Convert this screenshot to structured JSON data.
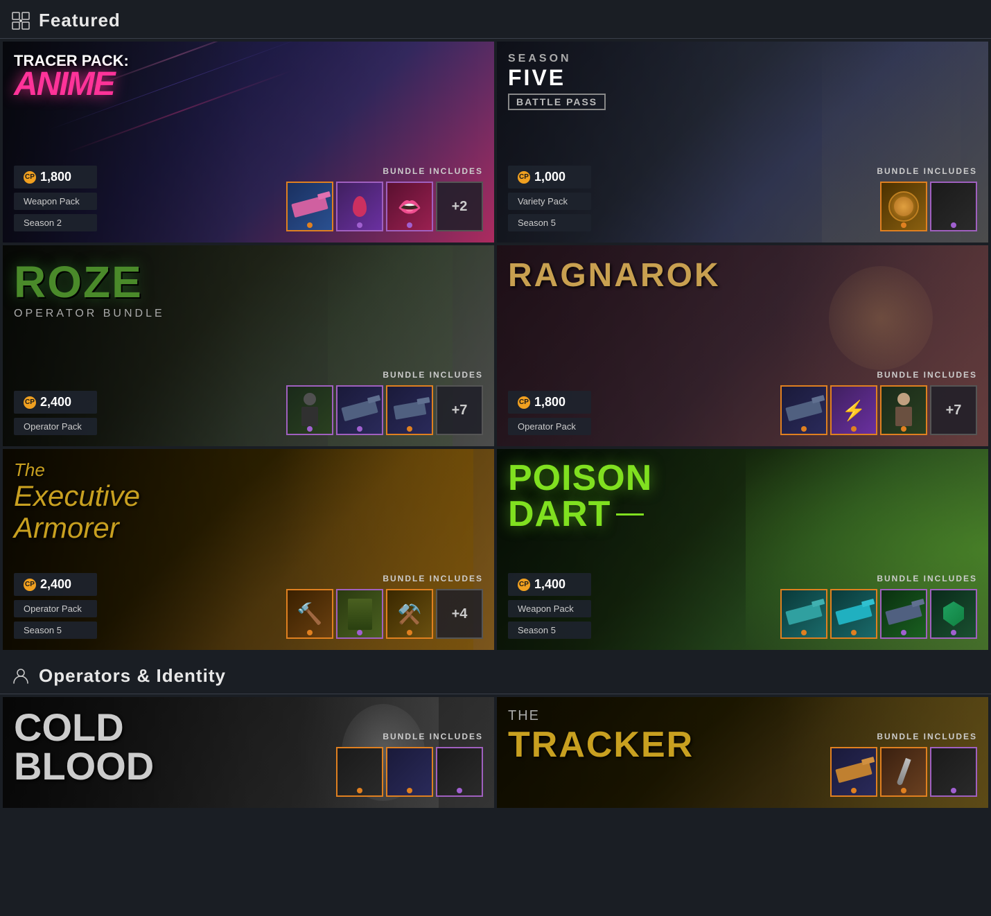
{
  "sections": {
    "featured": {
      "label": "Featured",
      "icon": "sparkle-icon"
    },
    "operators": {
      "label": "Operators & Identity",
      "icon": "person-icon"
    }
  },
  "featured_cards": [
    {
      "id": "tracer-anime",
      "title_line1": "TRACER PACK:",
      "title_line2": "ANIME",
      "price": "1,800",
      "tag1": "Weapon Pack",
      "tag2": "Season 2",
      "includes_label": "BUNDLE INCLUDES",
      "extra_count": "+2",
      "bg_class": "bg-tracer-anime"
    },
    {
      "id": "season5-bp",
      "title_line1": "SEASON FIVE",
      "title_line2": "BATTLE PASS",
      "price": "1,000",
      "tag1": "Variety Pack",
      "tag2": "Season 5",
      "includes_label": "BUNDLE INCLUDES",
      "extra_count": null,
      "bg_class": "bg-season5-bp"
    },
    {
      "id": "roze",
      "title_line1": "ROZE",
      "title_line2": "OPERATOR BUNDLE",
      "price": "2,400",
      "tag1": "Operator Pack",
      "tag2": null,
      "includes_label": "BUNDLE INCLUDES",
      "extra_count": "+7",
      "bg_class": "bg-roze"
    },
    {
      "id": "ragnarok",
      "title_line1": "RAGNAROK",
      "title_line2": null,
      "price": "1,800",
      "tag1": "Operator Pack",
      "tag2": null,
      "includes_label": "BUNDLE INCLUDES",
      "extra_count": "+7",
      "bg_class": "bg-ragnarok"
    },
    {
      "id": "executive",
      "title_the": "The",
      "title_line1": "Executive",
      "title_line2": "Armorer",
      "price": "2,400",
      "tag1": "Operator Pack",
      "tag2": "Season 5",
      "includes_label": "BUNDLE INCLUDES",
      "extra_count": "+4",
      "bg_class": "bg-executive"
    },
    {
      "id": "poison-dart",
      "title_line1": "POISON",
      "title_line2": "DART",
      "price": "1,400",
      "tag1": "Weapon Pack",
      "tag2": "Season 5",
      "includes_label": "BUNDLE INCLUDES",
      "extra_count": null,
      "bg_class": "bg-poison"
    }
  ],
  "operator_cards": [
    {
      "id": "cold-blood",
      "title_line1": "COLD",
      "title_line2": "BLOOD",
      "includes_label": "BUNDLE INCLUDES",
      "bg_class": "bg-cold-blood"
    },
    {
      "id": "tracker",
      "title_the": "THE",
      "title_main": "TRACKER",
      "includes_label": "BUNDLE INCLUDES",
      "bg_class": "bg-tracker"
    }
  ]
}
